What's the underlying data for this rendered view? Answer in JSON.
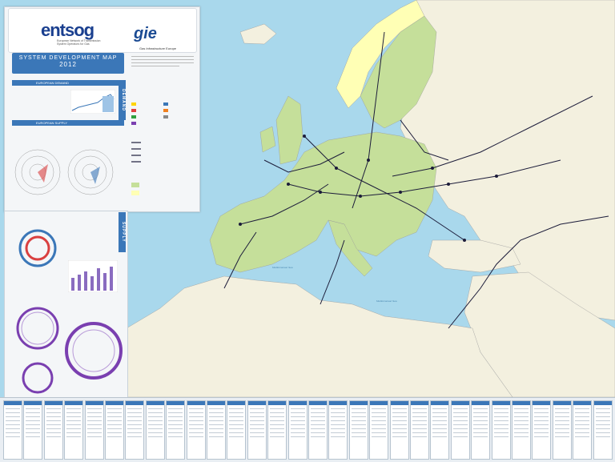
{
  "header": {
    "logo_main": "entsog",
    "logo_main_sub": "European Network of Transmission System Operators for Gas",
    "logo_partner": "gie",
    "logo_partner_sub": "Gas Infrastructure Europe",
    "title": "SYSTEM DEVELOPMENT MAP",
    "year": "2012"
  },
  "sections": {
    "demand_bar": "EUROPEAN DEMAND",
    "supply_bar": "EUROPEAN SUPPLY",
    "demand_tab": "DEMAND",
    "supply_tab": "SUPPLY"
  },
  "sea_labels": {
    "med": "Mediterranean Sea"
  },
  "colors": {
    "sea": "#a9d8ec",
    "land_other": "#f3f0df",
    "land_eu": "#c5df9a",
    "land_norway": "#ffffb5",
    "accent": "#3b77b8",
    "pipeline": "#1c1c3a",
    "purple_ring": "#7a3fb0"
  },
  "footer_card_count": 30
}
